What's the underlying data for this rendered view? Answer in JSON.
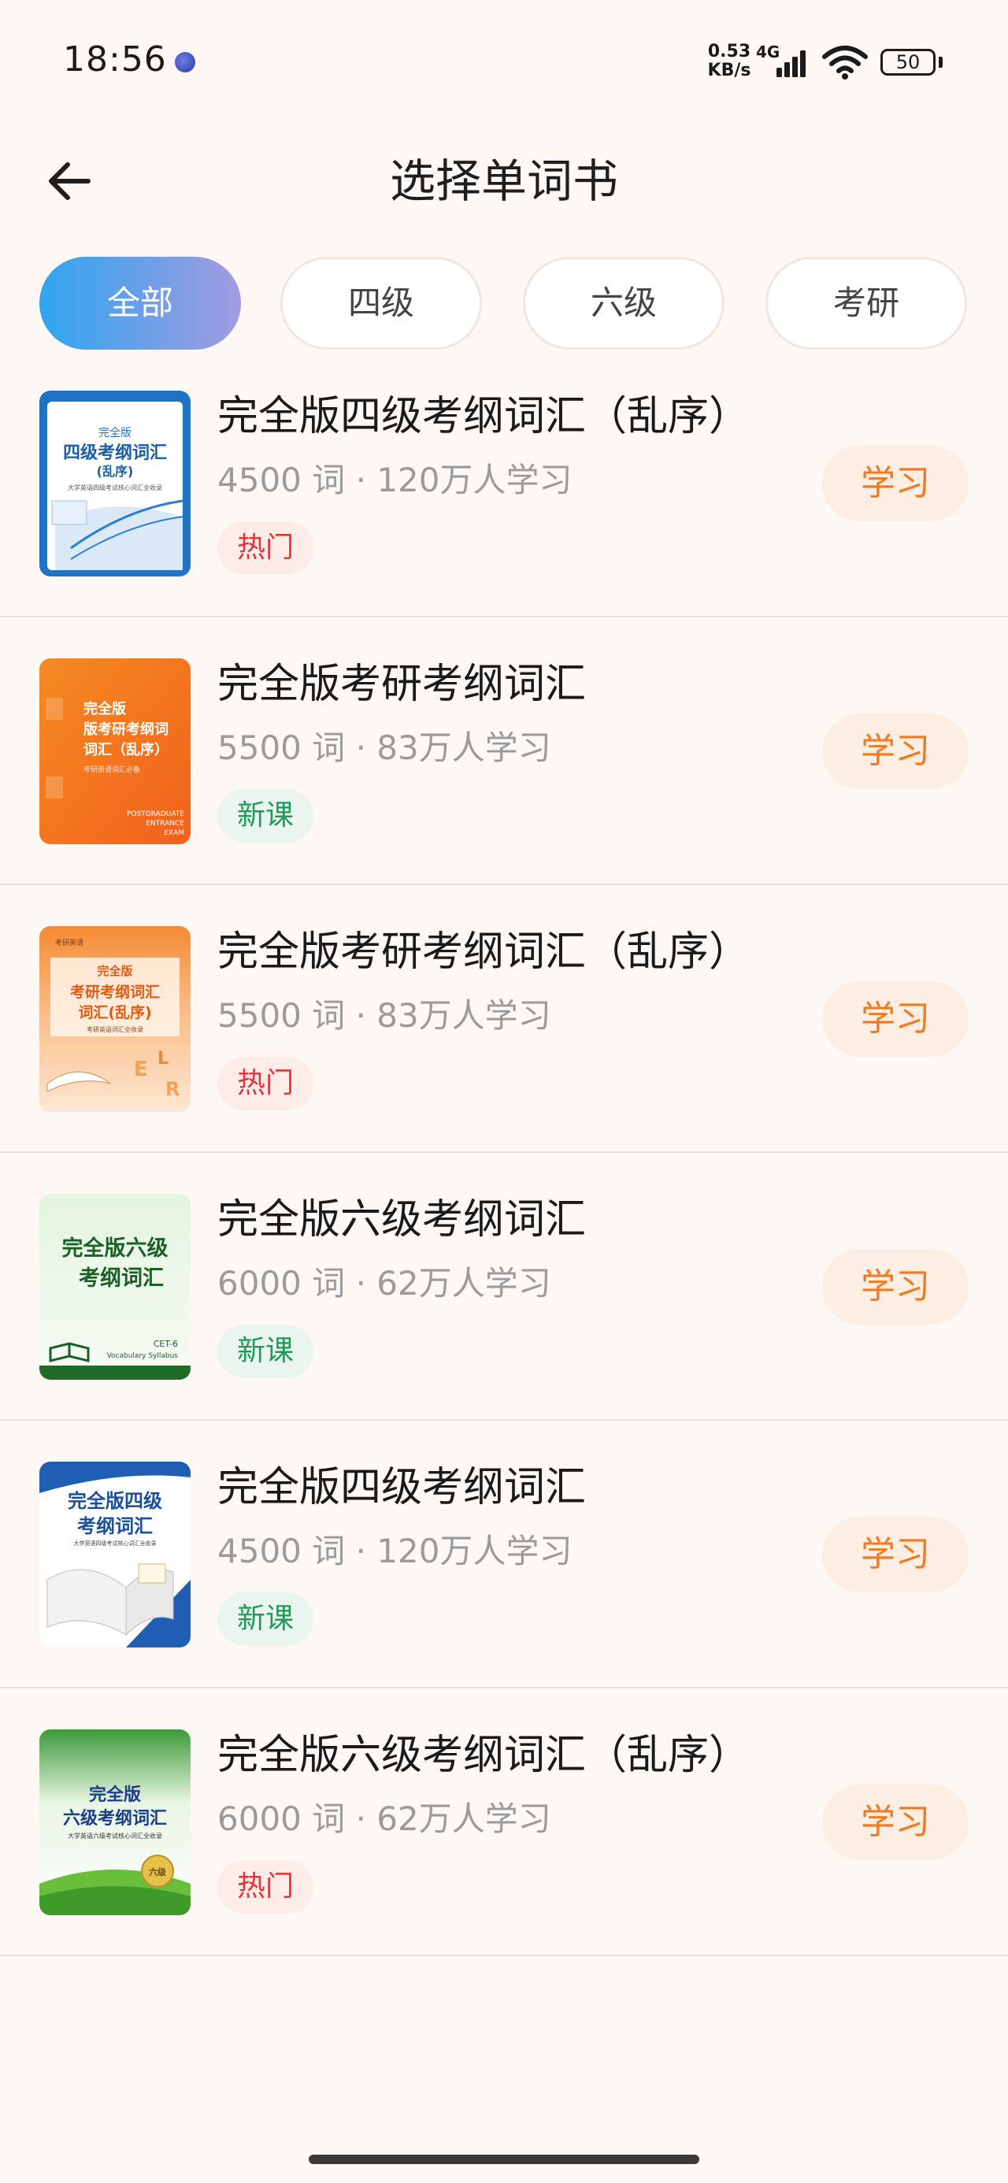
{
  "status_bar": {
    "time": "18:56",
    "net_speed_value": "0.53",
    "net_speed_unit": "KB/s",
    "net_type": "4G",
    "battery": "50"
  },
  "header": {
    "back_icon": "arrow-left-icon",
    "title": "选择单词书"
  },
  "tabs": [
    {
      "label": "全部",
      "active": true
    },
    {
      "label": "四级",
      "active": false
    },
    {
      "label": "六级",
      "active": false
    },
    {
      "label": "考研",
      "active": false
    }
  ],
  "books": [
    {
      "title": "完全版四级考纲词汇（乱序）",
      "meta": "4500 词 · 120万人学习",
      "tag": "热门",
      "action": "学习",
      "cover": {
        "line1": "完全版",
        "line2": "四级考纲词汇",
        "line3": "(乱序)",
        "line4": "大学英语四级考试核心词汇全收录"
      }
    },
    {
      "title": "完全版考研考纲词汇",
      "meta": "5500 词 · 83万人学习",
      "tag": "新课",
      "action": "学习",
      "cover": {
        "line1": "完全版",
        "line2": "版考研考纲词",
        "line3": "词汇（乱序）",
        "line4": "考研英语词汇必备",
        "line5": "POSTGRADUATE",
        "line6": "ENTRANCE",
        "line7": "EXAM"
      }
    },
    {
      "title": "完全版考研考纲词汇（乱序）",
      "meta": "5500 词 · 83万人学习",
      "tag": "热门",
      "action": "学习",
      "cover": {
        "line0": "考研英语",
        "line1": "完全版",
        "line2": "考研考纲词汇",
        "line3": "词汇(乱序)",
        "line4": "考研英语词汇全收录"
      }
    },
    {
      "title": "完全版六级考纲词汇",
      "meta": "6000 词 · 62万人学习",
      "tag": "新课",
      "action": "学习",
      "cover": {
        "line1": "完全版六级",
        "line2": "考纲词汇",
        "line3": "CET-6",
        "line4": "Vocabulary Syllabus"
      }
    },
    {
      "title": "完全版四级考纲词汇",
      "meta": "4500 词 · 120万人学习",
      "tag": "新课",
      "action": "学习",
      "cover": {
        "line1": "完全版四级",
        "line2": "考纲词汇",
        "line3": "大学英语四级考试核心词汇全收录"
      }
    },
    {
      "title": "完全版六级考纲词汇（乱序）",
      "meta": "6000 词 · 62万人学习",
      "tag": "热门",
      "action": "学习",
      "cover": {
        "line1": "完全版",
        "line2": "六级考纲词汇",
        "line3": "大学英语六级考试核心词汇全收录",
        "line4": "六级"
      }
    }
  ],
  "colors": {
    "accent": "#f07a22",
    "tab_gradient_start": "#2ea6f0",
    "tab_gradient_end": "#a39be0",
    "hot": "#e0353b",
    "new": "#1f9a5a"
  }
}
